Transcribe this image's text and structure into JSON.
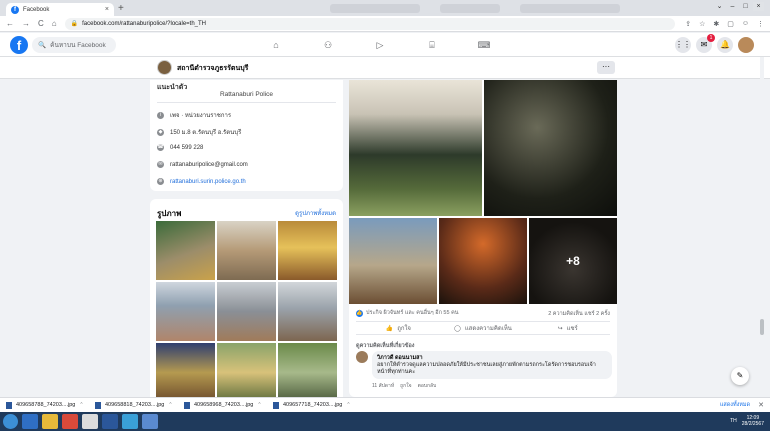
{
  "browser": {
    "tab_title": "Facebook",
    "url": "facebook.com/rattanaburipolice/?locale=th_TH",
    "nav": {
      "back": "←",
      "forward": "→",
      "reload": "C",
      "home": "⌂"
    },
    "toolbar_icons": [
      "⇪",
      "☆",
      "✱",
      "▢",
      "☺",
      "⋮"
    ]
  },
  "fb": {
    "logo": "f",
    "search_placeholder": "ค้นหาบน Facebook",
    "nav_icons": [
      "⌂",
      "⚇",
      "▷",
      "⌸",
      "⌨"
    ],
    "right_icons": {
      "menu": "⋮⋮",
      "messenger": "✉",
      "notifications": "🔔",
      "notif_badge": "1"
    }
  },
  "page": {
    "name": "สถานีตำรวจภูธรรัตนบุรี",
    "more_label": "···"
  },
  "intro": {
    "cut_title": "แนะนำตัว",
    "subname": "Rattanaburi Police",
    "rows": [
      {
        "icon": "i",
        "text": "เพจ · หน่วยงานราชการ"
      },
      {
        "icon": "◆",
        "text": "150 ม.8 ต.รัตนบุรี อ.รัตนบุรี"
      },
      {
        "icon": "☎",
        "text": "044 599 228"
      },
      {
        "icon": "✉",
        "text": "rattanaburipolice@gmail.com"
      },
      {
        "icon": "⊕",
        "text": "rattanaburi.surin.police.go.th"
      }
    ]
  },
  "photos": {
    "title": "รูปภาพ",
    "see_all": "ดูรูปภาพทั้งหมด"
  },
  "post": {
    "more_count": "+8",
    "reaction_icon": "👍",
    "reactors": "ประกิจ ผิวจันทร์ และ คนอื่นๆ อีก 55 คน",
    "counts": "2 ความคิดเห็น  แชร์ 2 ครั้ง",
    "actions": {
      "like": "ถูกใจ",
      "comment": "แสดงความคิดเห็น",
      "share": "แชร์"
    },
    "relevant_label": "ดูความคิดเห็นที่เกี่ยวข้อง",
    "comment": {
      "author": "วิภาวดี ดอนนามสา",
      "text": "อยากให้ตำรวจดูแลความปลอดภัยให้มีประชาชนเลยสู่ภายพักตามรถกระโดรัดการชอบรอบเจ้าหน้าที่ทุกท่านคะ",
      "meta": {
        "time": "11 สัปดาห์",
        "like": "ถูกใจ",
        "reply": "ตอบกลับ"
      }
    }
  },
  "fab_icon": "✎",
  "downloads": {
    "items": [
      {
        "name": "409658788_74203....jpg"
      },
      {
        "name": "409658818_74203....jpg"
      },
      {
        "name": "409658968_74203....jpg"
      },
      {
        "name": "409657718_74203....jpg"
      }
    ],
    "show_all": "แสดงทั้งหมด",
    "close": "✕"
  },
  "taskbar": {
    "tray": "TH",
    "time": "12:09",
    "date": "28/2/2567"
  }
}
